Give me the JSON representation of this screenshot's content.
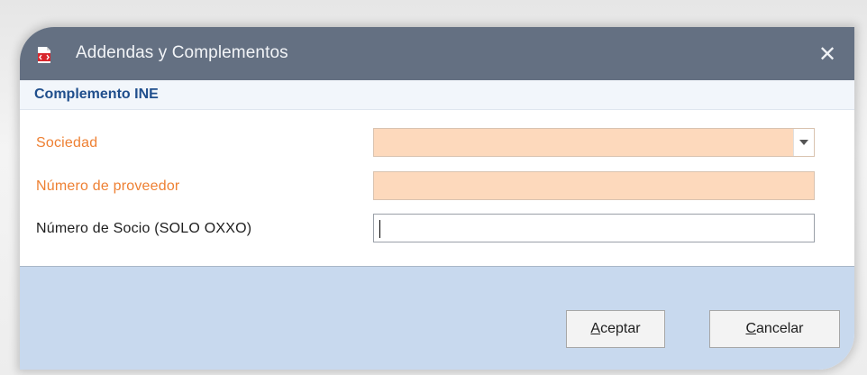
{
  "window": {
    "title": "Addendas y Complementos",
    "close_symbol": "✕",
    "icon": "pdf-document-icon"
  },
  "section": {
    "title": "Complemento INE"
  },
  "form": {
    "fields": [
      {
        "label": "Sociedad",
        "value": "",
        "required": true,
        "type": "select"
      },
      {
        "label": "Número de proveedor",
        "value": "",
        "required": true,
        "type": "text"
      },
      {
        "label": "Número de Socio (SOLO OXXO)",
        "value": "",
        "required": false,
        "type": "text"
      }
    ]
  },
  "buttons": {
    "accept": {
      "accel": "A",
      "rest": "ceptar"
    },
    "cancel": {
      "accel": "C",
      "rest": "ancelar"
    }
  },
  "colors": {
    "titlebar": "#647082",
    "required_label": "#ee8033",
    "required_field": "#fdd9bc",
    "section_title": "#1f4e8c",
    "footer": "#c8d9ee"
  }
}
